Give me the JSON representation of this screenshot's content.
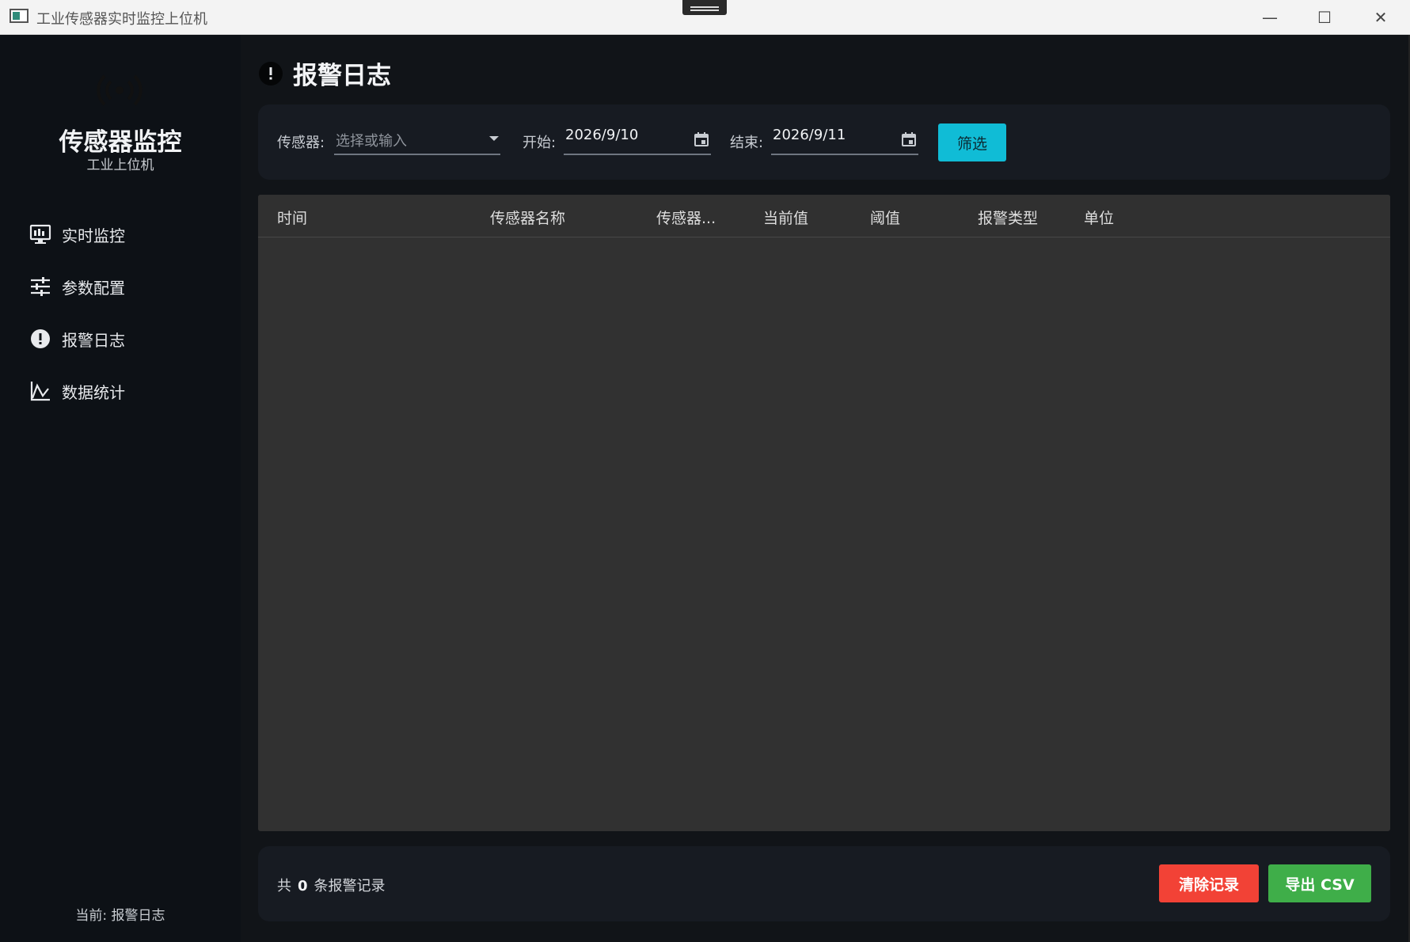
{
  "window": {
    "title": "工业传感器实时监控上位机"
  },
  "sidebar": {
    "brand_title": "传感器监控",
    "brand_subtitle": "工业上位机",
    "items": [
      {
        "label": "实时监控",
        "icon": "monitor-icon"
      },
      {
        "label": "参数配置",
        "icon": "sliders-icon"
      },
      {
        "label": "报警日志",
        "icon": "alert-icon"
      },
      {
        "label": "数据统计",
        "icon": "chart-icon"
      }
    ],
    "footer": "当前: 报警日志"
  },
  "page": {
    "title": "报警日志",
    "icon": "alert-icon"
  },
  "filter": {
    "sensor_label": "传感器:",
    "sensor_placeholder": "选择或输入",
    "start_label": "开始:",
    "start_value": "2026/9/10",
    "end_label": "结束:",
    "end_value": "2026/9/11",
    "filter_button": "筛选"
  },
  "table": {
    "columns": [
      "时间",
      "传感器名称",
      "传感器...",
      "当前值",
      "阈值",
      "报警类型",
      "单位"
    ],
    "rows": []
  },
  "footer": {
    "count_prefix": "共",
    "count": "0",
    "count_suffix": "条报警记录",
    "clear_button": "清除记录",
    "export_button": "导出 CSV"
  },
  "colors": {
    "filter_button": "#10bcd6",
    "clear_button": "#f24236",
    "export_button": "#3fae49"
  }
}
